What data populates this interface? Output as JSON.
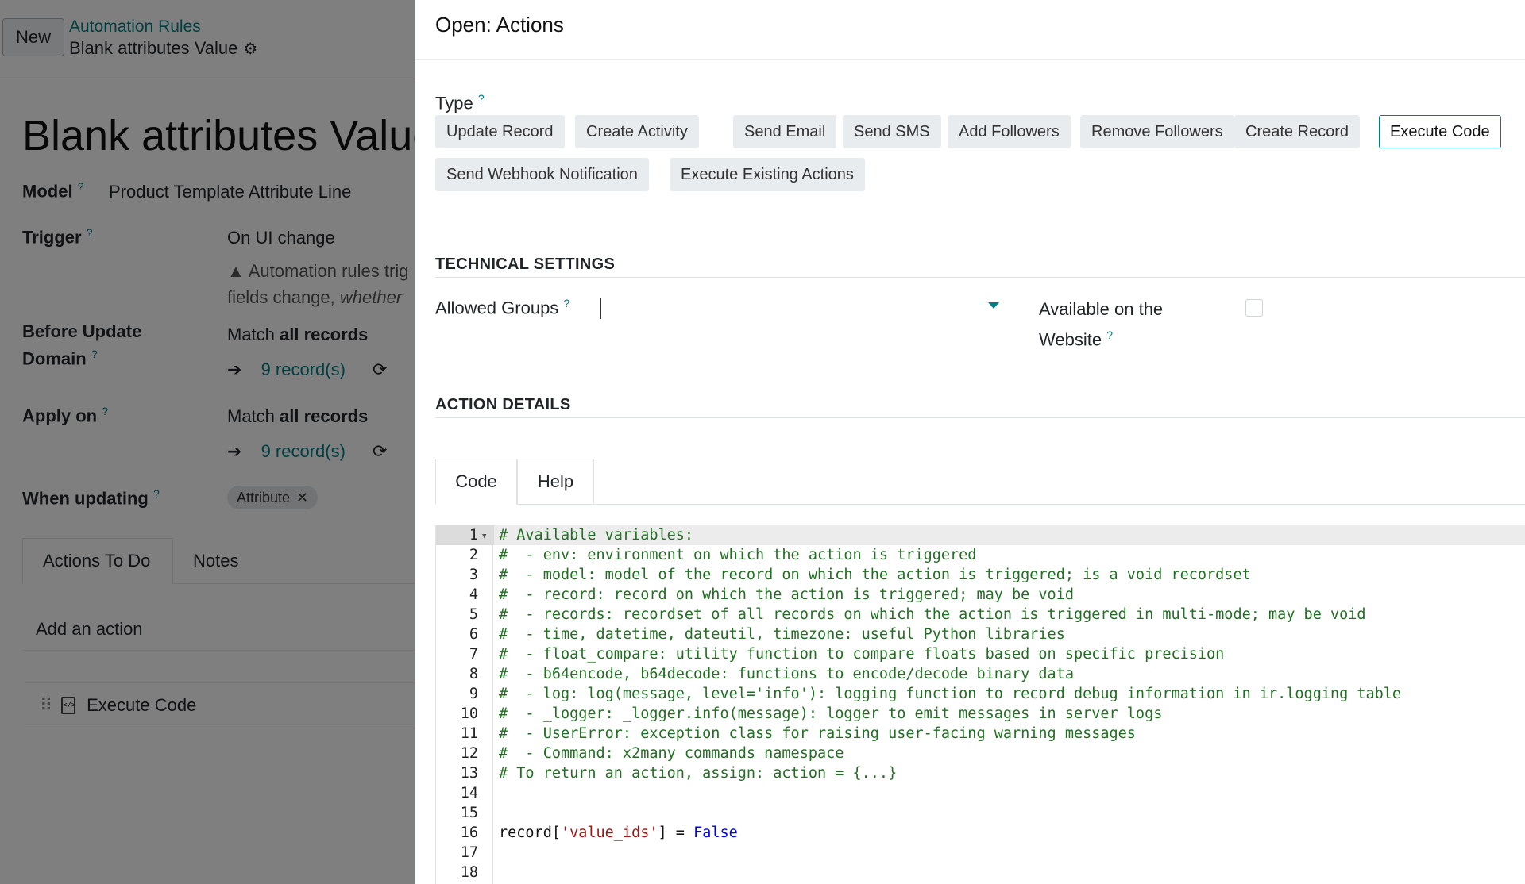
{
  "background": {
    "new_button": "New",
    "breadcrumb_parent": "Automation Rules",
    "breadcrumb_current": "Blank attributes Value",
    "record_title": "Blank attributes Value",
    "model_label": "Model",
    "model_value": "Product Template Attribute Line",
    "trigger_label": "Trigger",
    "trigger_value": "On UI change",
    "trigger_note_1": "Automation rules trig",
    "trigger_note_2a": "fields change, ",
    "trigger_note_2b": "whether",
    "before_label_1": "Before Update",
    "before_label_2": "Domain",
    "before_match": "Match ",
    "before_match_bold": "all records",
    "before_records": "9 record(s)",
    "apply_label": "Apply on",
    "apply_match": "Match ",
    "apply_match_bold": "all records",
    "apply_records": "9 record(s)",
    "when_label": "When updating",
    "when_tag": "Attribute",
    "tabs": [
      "Actions To Do",
      "Notes"
    ],
    "add_action": "Add an action",
    "action_row": "Execute Code",
    "help_mark": "?"
  },
  "dialog": {
    "title": "Open: Actions",
    "type_label": "Type",
    "type_options": [
      "Update Record",
      "Create Activity",
      "Send Email",
      "Send SMS",
      "Add Followers",
      "Remove Followers",
      "Create Record",
      "Execute Code",
      "Send Webhook Notification",
      "Execute Existing Actions"
    ],
    "type_selected": "Execute Code",
    "technical_settings": "TECHNICAL SETTINGS",
    "allowed_groups_label": "Allowed Groups",
    "allowed_groups_value": "",
    "website_label_1": "Available on the",
    "website_label_2": "Website",
    "website_checked": false,
    "action_details": "ACTION DETAILS",
    "code_tabs": [
      "Code",
      "Help"
    ],
    "active_code_tab": "Code",
    "code_lines": [
      "# Available variables:",
      "#  - env: environment on which the action is triggered",
      "#  - model: model of the record on which the action is triggered; is a void recordset",
      "#  - record: record on which the action is triggered; may be void",
      "#  - records: recordset of all records on which the action is triggered in multi-mode; may be void",
      "#  - time, datetime, dateutil, timezone: useful Python libraries",
      "#  - float_compare: utility function to compare floats based on specific precision",
      "#  - b64encode, b64decode: functions to encode/decode binary data",
      "#  - log: log(message, level='info'): logging function to record debug information in ir.logging table",
      "#  - _logger: _logger.info(message): logger to emit messages in server logs",
      "#  - UserError: exception class for raising user-facing warning messages",
      "#  - Command: x2many commands namespace",
      "# To return an action, assign: action = {...}",
      "",
      "",
      "",
      "",
      ""
    ],
    "code_line16_a": "record[",
    "code_line16_str": "'value_ids'",
    "code_line16_b": "] = ",
    "code_line16_kw": "False",
    "line_numbers": [
      "1",
      "2",
      "3",
      "4",
      "5",
      "6",
      "7",
      "8",
      "9",
      "10",
      "11",
      "12",
      "13",
      "14",
      "15",
      "16",
      "17",
      "18"
    ]
  },
  "colors": {
    "accent": "#017e84",
    "comment": "#236e24",
    "string": "#a31515",
    "keyword": "#0000ff"
  }
}
